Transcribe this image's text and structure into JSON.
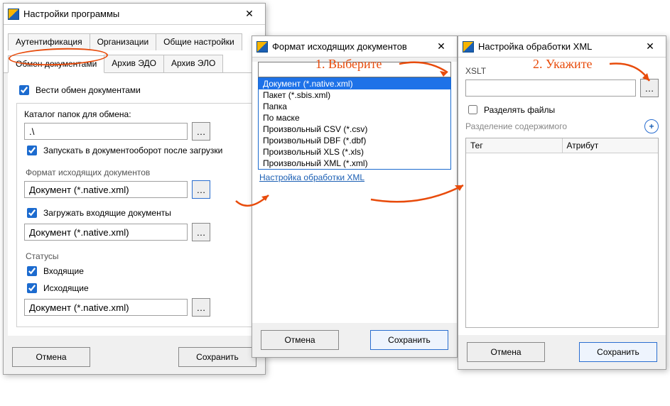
{
  "win1": {
    "title": "Настройки программы",
    "tabs_row1": [
      "Аутентификация",
      "Организации",
      "Общие настройки"
    ],
    "tabs_row2": [
      "Обмен документами",
      "Архив ЭДО",
      "Архив ЭЛО"
    ],
    "active_tab": "Обмен документами",
    "enable_exchange": "Вести обмен документами",
    "catalog_label": "Каталог папок для обмена:",
    "catalog_value": ".\\",
    "autosend": "Запускать в документооборот после загрузки",
    "out_format_label": "Формат исходящих документов",
    "out_format_value": "Документ (*.native.xml)",
    "load_incoming": "Загружать входящие документы",
    "in_format_value": "Документ (*.native.xml)",
    "statuses_label": "Статусы",
    "incoming": "Входящие",
    "outgoing": "Исходящие",
    "status_format_value": "Документ (*.native.xml)",
    "cancel": "Отмена",
    "save": "Сохранить"
  },
  "win2": {
    "title": "Формат исходящих документов",
    "items": [
      "Документ (*.native.xml)",
      "Пакет (*.sbis.xml)",
      "Папка",
      "По маске",
      "Произвольный CSV (*.csv)",
      "Произвольный DBF (*.dbf)",
      "Произвольный XLS (*.xls)",
      "Произвольный XML (*.xml)"
    ],
    "link": "Настройка обработки XML",
    "cancel": "Отмена",
    "save": "Сохранить"
  },
  "win3": {
    "title": "Настройка обработки XML",
    "xslt_label": "XSLT",
    "split": "Разделять файлы",
    "split_content": "Разделение содержимого",
    "col_tag": "Тег",
    "col_attr": "Атрибут",
    "cancel": "Отмена",
    "save": "Сохранить"
  },
  "anno": {
    "step1": "1. Выберите",
    "step2": "2. Укажите"
  }
}
